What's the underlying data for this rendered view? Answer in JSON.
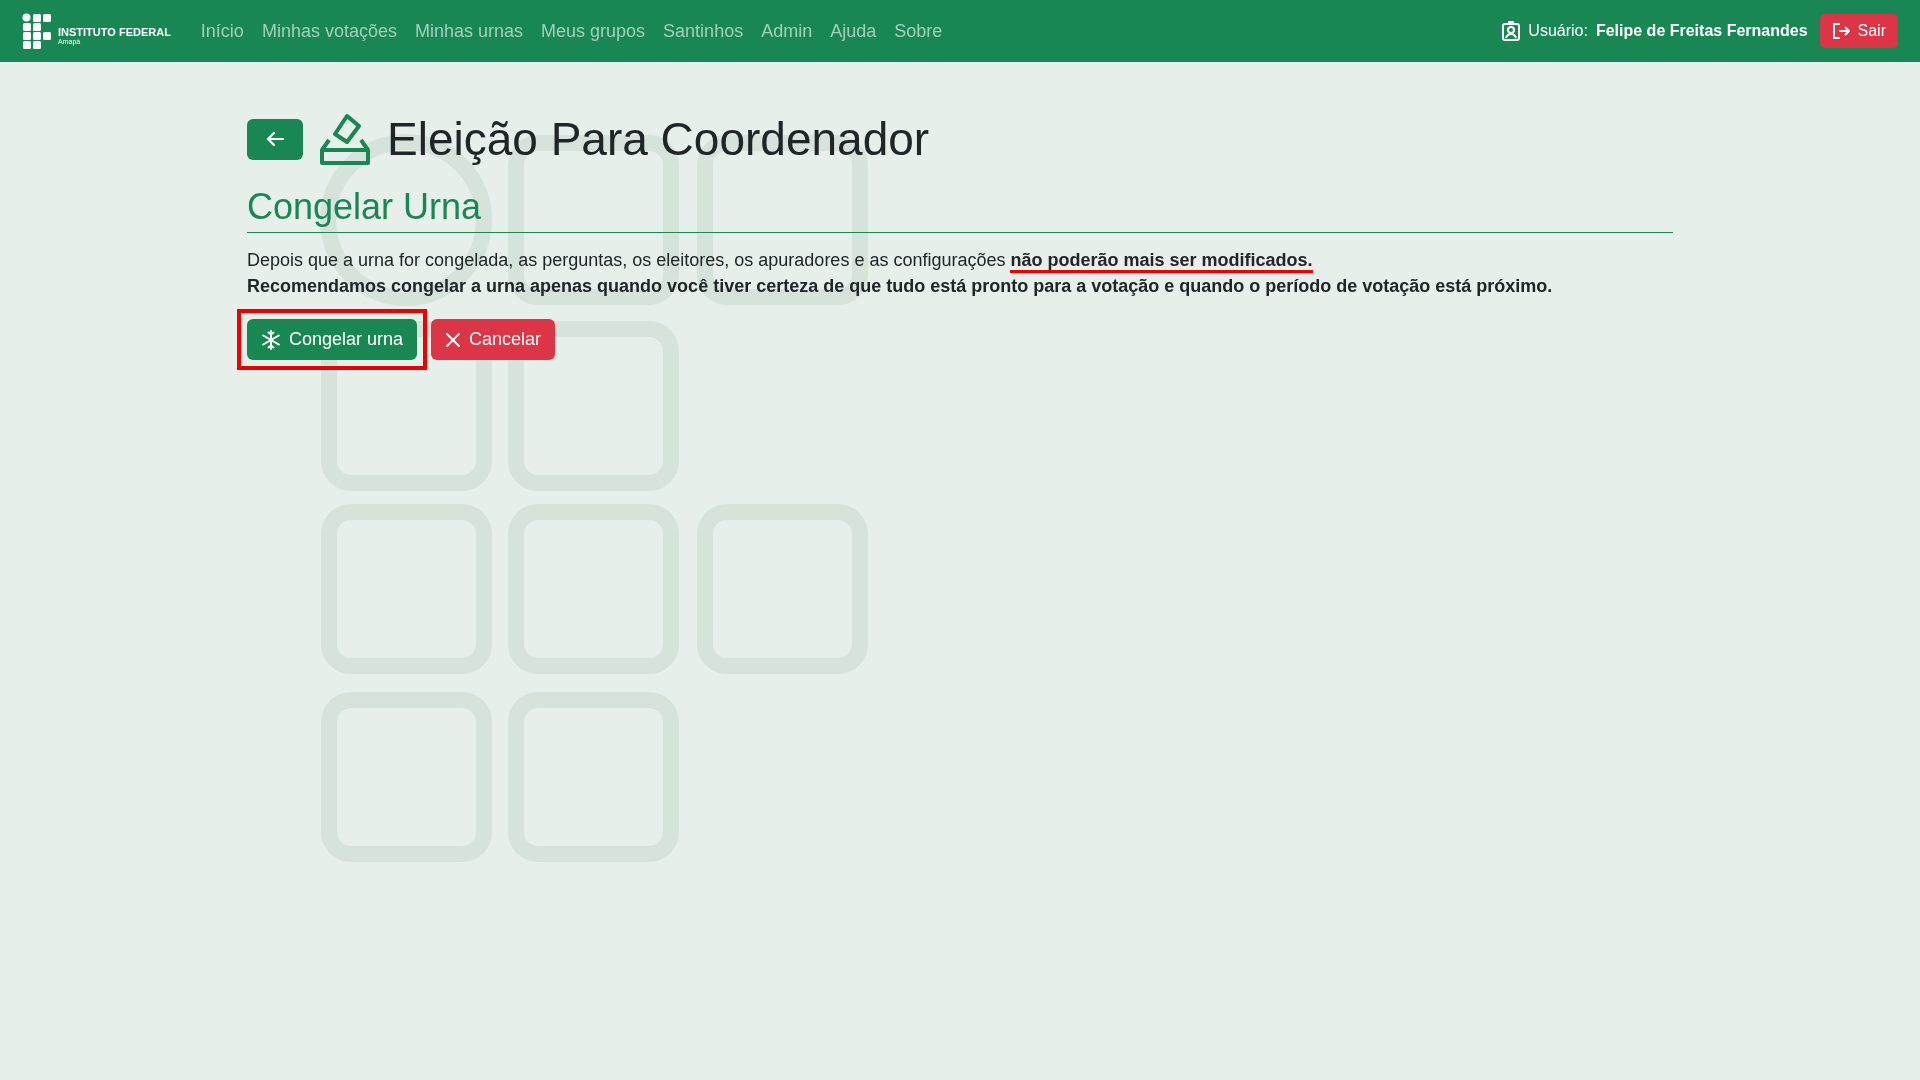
{
  "navbar": {
    "logo": {
      "title": "INSTITUTO FEDERAL",
      "subtitle": "Amapá"
    },
    "links": [
      {
        "label": "Início"
      },
      {
        "label": "Minhas votações"
      },
      {
        "label": "Minhas urnas"
      },
      {
        "label": "Meus grupos"
      },
      {
        "label": "Santinhos"
      },
      {
        "label": "Admin"
      },
      {
        "label": "Ajuda"
      },
      {
        "label": "Sobre"
      }
    ],
    "user": {
      "label": "Usuário:",
      "name": "Felipe de Freitas Fernandes"
    },
    "logout": "Sair"
  },
  "page": {
    "title": "Eleição Para Coordenador",
    "section": "Congelar Urna",
    "paragraphs": [
      "Depois que a urna for congelada, as perguntas, os eleitores, os apuradores e as configurações **não poderão mais ser modificados.**",
      "Recomendamos congelar a urna apenas quando você tiver certeza de que tudo está pronto para a votação e quando o período de votação está próximo."
    ],
    "buttons": [
      {
        "kind": "confirm",
        "label": "Congelar urna",
        "highlighted": true
      },
      {
        "kind": "cancel",
        "label": "Cancelar",
        "highlighted": false
      }
    ]
  }
}
